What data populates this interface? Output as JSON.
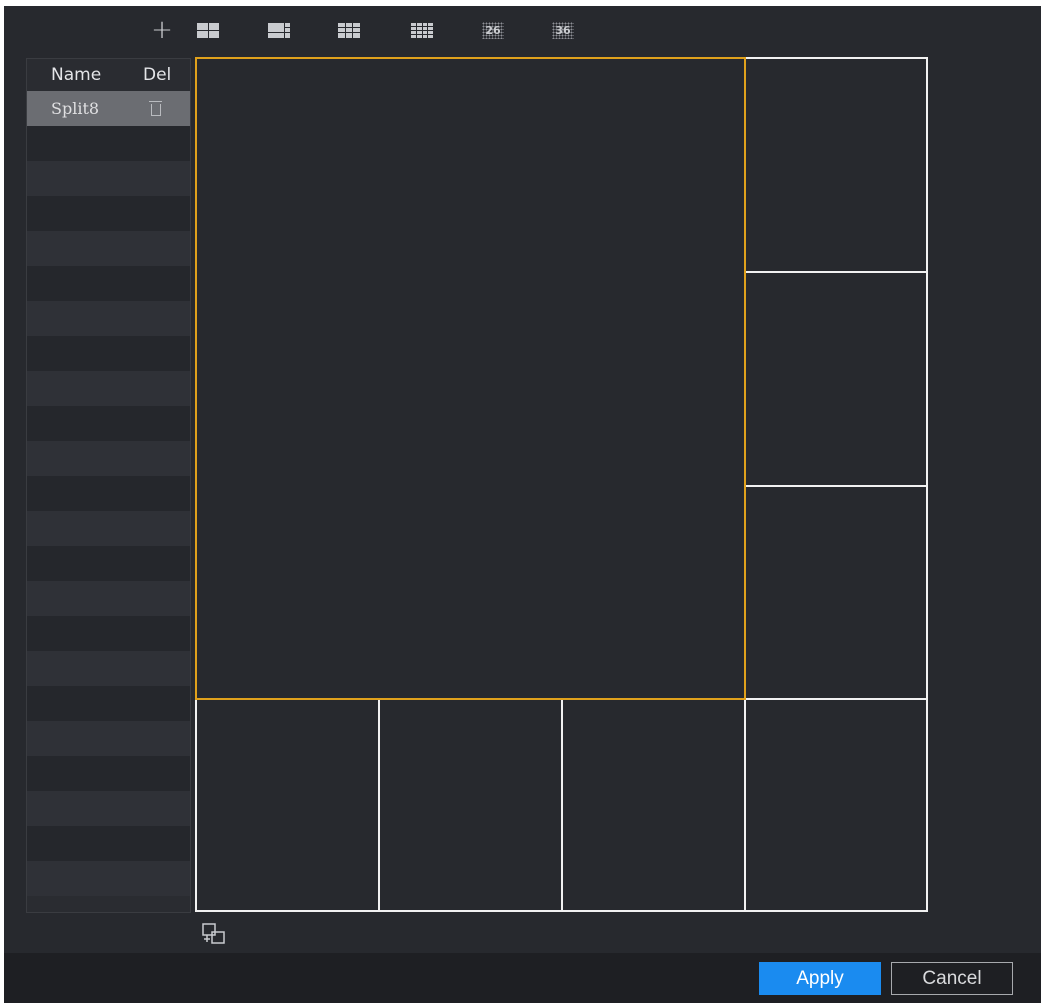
{
  "toolbar": {
    "add_label": "+",
    "preset_26_label": "26",
    "preset_36_label": "36",
    "buttons": [
      "plus-icon",
      "split-4-icon",
      "split-8-icon",
      "split-9-icon",
      "split-16-icon",
      "split-25-icon",
      "split-36-icon"
    ]
  },
  "list": {
    "header_name": "Name",
    "header_del": "Del",
    "items": [
      {
        "name": "Split8",
        "selected": true
      }
    ]
  },
  "split": {
    "layout": "Split8",
    "active_cell": 1,
    "active_color": "#e0a11c",
    "border_color": "#f1f1f1"
  },
  "footer": {
    "apply_label": "Apply",
    "cancel_label": "Cancel",
    "apply_color": "#1a8bf0"
  }
}
